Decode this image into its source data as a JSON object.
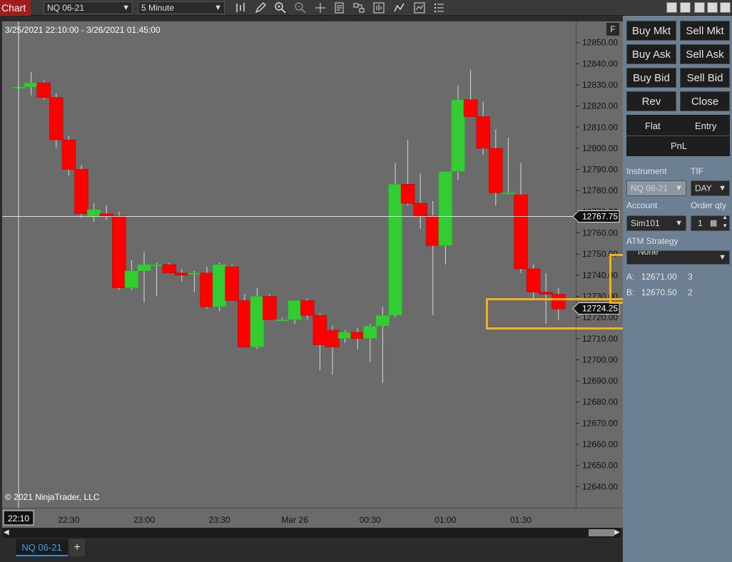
{
  "toolbar": {
    "chart_tab": "Chart",
    "instrument": "NQ 06-21",
    "interval": "5 Minute",
    "icons": [
      "bar-type-icon",
      "draw-pencil-icon",
      "zoom-in-icon",
      "zoom-out-icon",
      "crosshair-icon",
      "properties-icon",
      "data-box-icon",
      "instruments-icon",
      "indicators-icon",
      "strategies-icon",
      "templates-icon"
    ]
  },
  "chart": {
    "date_range": "3/25/2021 22:10:00 - 3/26/2021 01:45:00",
    "copyright": "© 2021 NinjaTrader, LLC",
    "f_badge": "F",
    "colors": {
      "up": "#33cc33",
      "down": "#ff0000",
      "background": "#6b6b6b"
    }
  },
  "chart_data": {
    "type": "candlestick",
    "ylim": [
      12630,
      12860
    ],
    "yticks": [
      12640,
      12650,
      12660,
      12670,
      12680,
      12690,
      12700,
      12710,
      12720,
      12730,
      12740,
      12750,
      12760,
      12770,
      12780,
      12790,
      12800,
      12810,
      12820,
      12830,
      12840,
      12850
    ],
    "ytick_labels": [
      "12640.00",
      "12650.00",
      "12660.00",
      "12670.00",
      "12680.00",
      "12690.00",
      "12700.00",
      "12710.00",
      "12720.00",
      "12730.00",
      "12740.00",
      "12750.00",
      "12760.00",
      "12770.00",
      "12780.00",
      "12790.00",
      "12800.00",
      "12810.00",
      "12820.00",
      "12830.00",
      "12840.00",
      "12850.00"
    ],
    "xtick_labels": [
      "22:10",
      "22:30",
      "23:00",
      "23:30",
      "Mar 26",
      "00:30",
      "01:00",
      "01:30"
    ],
    "xtick_bar_index": [
      0,
      4,
      10,
      16,
      22,
      28,
      34,
      40
    ],
    "crosshair_price": "12767.75",
    "current_price": "12724.25",
    "candles": [
      {
        "o": 12829,
        "h": 12833,
        "l": 12824,
        "c": 12829
      },
      {
        "o": 12829,
        "h": 12836,
        "l": 12825,
        "c": 12831
      },
      {
        "o": 12831,
        "h": 12832,
        "l": 12823,
        "c": 12824
      },
      {
        "o": 12824,
        "h": 12826,
        "l": 12800,
        "c": 12804
      },
      {
        "o": 12804,
        "h": 12806,
        "l": 12787,
        "c": 12790
      },
      {
        "o": 12790,
        "h": 12792,
        "l": 12767,
        "c": 12769
      },
      {
        "o": 12768,
        "h": 12774,
        "l": 12765,
        "c": 12771
      },
      {
        "o": 12769,
        "h": 12773,
        "l": 12766,
        "c": 12768
      },
      {
        "o": 12768,
        "h": 12770,
        "l": 12733,
        "c": 12734
      },
      {
        "o": 12734,
        "h": 12747,
        "l": 12733,
        "c": 12742
      },
      {
        "o": 12742,
        "h": 12751,
        "l": 12727,
        "c": 12745
      },
      {
        "o": 12745,
        "h": 12746,
        "l": 12730,
        "c": 12745
      },
      {
        "o": 12745,
        "h": 12746,
        "l": 12741,
        "c": 12741
      },
      {
        "o": 12741,
        "h": 12743,
        "l": 12737,
        "c": 12740
      },
      {
        "o": 12741,
        "h": 12742,
        "l": 12732,
        "c": 12741
      },
      {
        "o": 12741,
        "h": 12744,
        "l": 12724,
        "c": 12725
      },
      {
        "o": 12725,
        "h": 12746,
        "l": 12723,
        "c": 12745
      },
      {
        "o": 12744,
        "h": 12745,
        "l": 12728,
        "c": 12728
      },
      {
        "o": 12728,
        "h": 12731,
        "l": 12706,
        "c": 12706
      },
      {
        "o": 12706,
        "h": 12734,
        "l": 12705,
        "c": 12730
      },
      {
        "o": 12730,
        "h": 12731,
        "l": 12719,
        "c": 12719
      },
      {
        "o": 12719,
        "h": 12720,
        "l": 12718,
        "c": 12719
      },
      {
        "o": 12719,
        "h": 12728,
        "l": 12717,
        "c": 12728
      },
      {
        "o": 12728,
        "h": 12729,
        "l": 12719,
        "c": 12721
      },
      {
        "o": 12721,
        "h": 12722,
        "l": 12695,
        "c": 12707
      },
      {
        "o": 12714,
        "h": 12716,
        "l": 12693,
        "c": 12706
      },
      {
        "o": 12710,
        "h": 12714,
        "l": 12708,
        "c": 12713
      },
      {
        "o": 12713,
        "h": 12715,
        "l": 12705,
        "c": 12710
      },
      {
        "o": 12710,
        "h": 12717,
        "l": 12699,
        "c": 12716
      },
      {
        "o": 12716,
        "h": 12725,
        "l": 12689,
        "c": 12721
      },
      {
        "o": 12721,
        "h": 12793,
        "l": 12720,
        "c": 12783
      },
      {
        "o": 12783,
        "h": 12804,
        "l": 12773,
        "c": 12774
      },
      {
        "o": 12774,
        "h": 12788,
        "l": 12762,
        "c": 12768
      },
      {
        "o": 12768,
        "h": 12775,
        "l": 12721,
        "c": 12754
      },
      {
        "o": 12754,
        "h": 12789,
        "l": 12745,
        "c": 12789
      },
      {
        "o": 12789,
        "h": 12830,
        "l": 12785,
        "c": 12823
      },
      {
        "o": 12823,
        "h": 12837,
        "l": 12815,
        "c": 12815
      },
      {
        "o": 12815,
        "h": 12822,
        "l": 12797,
        "c": 12800
      },
      {
        "o": 12800,
        "h": 12809,
        "l": 12773,
        "c": 12779
      },
      {
        "o": 12779,
        "h": 12805,
        "l": 12778,
        "c": 12779
      },
      {
        "o": 12778,
        "h": 12793,
        "l": 12741,
        "c": 12743
      },
      {
        "o": 12743,
        "h": 12745,
        "l": 12728,
        "c": 12732
      },
      {
        "o": 12732,
        "h": 12741,
        "l": 12717,
        "c": 12731
      },
      {
        "o": 12731,
        "h": 12734,
        "l": 12719,
        "c": 12724
      }
    ]
  },
  "order_panel": {
    "buy_mkt": "Buy Mkt",
    "sell_mkt": "Sell Mkt",
    "buy_ask": "Buy Ask",
    "sell_ask": "Sell Ask",
    "buy_bid": "Buy Bid",
    "sell_bid": "Sell Bid",
    "rev": "Rev",
    "close": "Close",
    "flat": "Flat",
    "entry": "Entry",
    "pnl": "PnL",
    "instrument_label": "Instrument",
    "instrument_value": "NQ 06-21",
    "tif_label": "TIF",
    "tif_value": "DAY",
    "account_label": "Account",
    "account_value": "Sim101",
    "order_qty_label": "Order qty",
    "order_qty_value": "1",
    "atm_label": "ATM Strategy",
    "atm_value": "None",
    "row_a_label": "A:",
    "row_a_price": "12671.00",
    "row_a_qty": "3",
    "row_b_label": "B:",
    "row_b_price": "12670.50",
    "row_b_qty": "2"
  },
  "bottom": {
    "instrument_tab": "NQ 06-21",
    "add_tab": "+"
  }
}
